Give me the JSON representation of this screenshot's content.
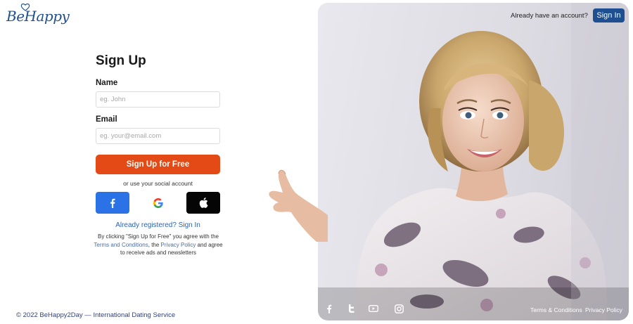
{
  "brand": {
    "logo_text": "BeHappy"
  },
  "header": {
    "have_account_text": "Already have an account?",
    "signin_label": "Sign In"
  },
  "form": {
    "title": "Sign Up",
    "name_label": "Name",
    "name_placeholder": "eg. John",
    "email_label": "Email",
    "email_placeholder": "eg. your@email.com",
    "submit_label": "Sign Up for Free",
    "social_caption": "or use your social account",
    "social_buttons": [
      "facebook-icon",
      "google-icon",
      "apple-icon"
    ],
    "already_registered": "Already registered? Sign In",
    "legal": {
      "part1": "By clicking \"Sign Up for Free\" you agree with the",
      "terms": "Terms and Conditions",
      "part2": ", the ",
      "privacy": "Privacy Policy",
      "part3": " and agree to receive ads and newsletters"
    }
  },
  "footer": {
    "copyright": "© 2022 BeHappy2Day — International Dating Service",
    "social_icons": [
      "facebook-icon",
      "twitter-icon",
      "youtube-icon",
      "instagram-icon"
    ],
    "terms_link": "Terms & Conditions",
    "privacy_link": "Privacy Policy"
  },
  "colors": {
    "brand_blue": "#1d4f91",
    "cta_orange": "#e34a16",
    "facebook_blue": "#2a72e5",
    "apple_black": "#050505"
  }
}
